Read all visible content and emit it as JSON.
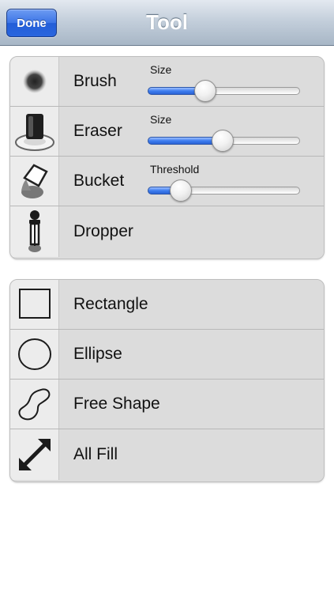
{
  "nav": {
    "title": "Tool",
    "done_label": "Done"
  },
  "tools": [
    {
      "label": "Brush",
      "icon": "brush-icon",
      "slider_label": "Size",
      "value": 0.38
    },
    {
      "label": "Eraser",
      "icon": "eraser-icon",
      "slider_label": "Size",
      "value": 0.49
    },
    {
      "label": "Bucket",
      "icon": "bucket-icon",
      "slider_label": "Threshold",
      "value": 0.22
    },
    {
      "label": "Dropper",
      "icon": "dropper-icon"
    }
  ],
  "shapes": [
    {
      "label": "Rectangle",
      "icon": "rectangle-icon"
    },
    {
      "label": "Ellipse",
      "icon": "ellipse-icon"
    },
    {
      "label": "Free Shape",
      "icon": "free-shape-icon"
    },
    {
      "label": "All Fill",
      "icon": "all-fill-icon"
    }
  ],
  "colors": {
    "accent": "#3f7ef0",
    "done_button": "#2a66de"
  }
}
